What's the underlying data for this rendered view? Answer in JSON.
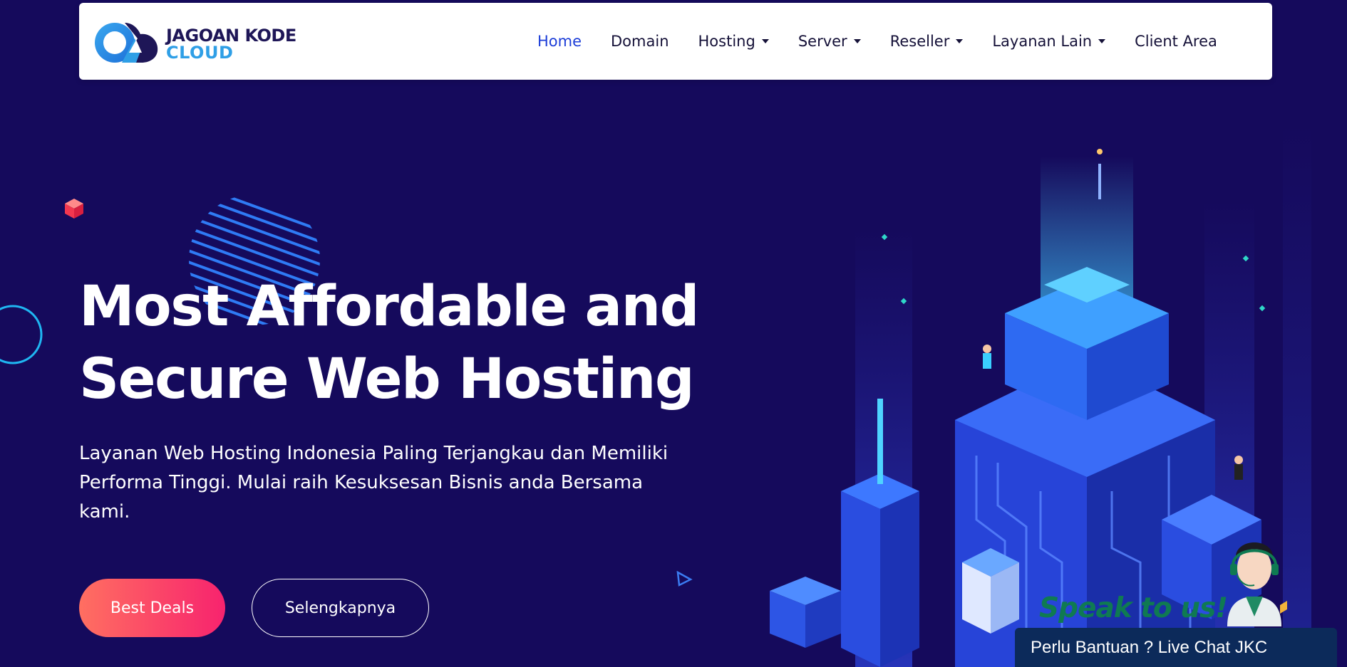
{
  "brand": {
    "name_top": "JAGOAN KODE",
    "name_bottom": "CLOUD",
    "colors": {
      "navy": "#1e1657",
      "blue": "#2f9fe6",
      "background": "#150a5c"
    }
  },
  "nav": {
    "items": [
      {
        "label": "Home",
        "active": true,
        "dropdown": false
      },
      {
        "label": "Domain",
        "active": false,
        "dropdown": false
      },
      {
        "label": "Hosting",
        "active": false,
        "dropdown": true
      },
      {
        "label": "Server",
        "active": false,
        "dropdown": true
      },
      {
        "label": "Reseller",
        "active": false,
        "dropdown": true
      },
      {
        "label": "Layanan Lain",
        "active": false,
        "dropdown": true
      },
      {
        "label": "Client Area",
        "active": false,
        "dropdown": false
      }
    ]
  },
  "hero": {
    "title_line1": "Most Affordable and",
    "title_line2": "Secure Web Hosting",
    "subtitle": "Layanan Web Hosting Indonesia Paling Terjangkau dan Memiliki Performa Tinggi. Mulai raih Kesuksesan Bisnis anda Bersama kami.",
    "primary_button": "Best Deals",
    "secondary_button": "Selengkapnya",
    "button_gradient": [
      "#ff6f61",
      "#f7236e"
    ]
  },
  "chat": {
    "speak_label": "Speak to us!",
    "bar_label": "Perlu Bantuan ? Live Chat JKC",
    "bar_color": "#0c2a5a"
  },
  "icons": [
    "cloud-logo-icon",
    "chevron-down-icon",
    "cube-icon",
    "ring-icon",
    "triangle-icon",
    "server-city-illustration",
    "support-agent-avatar"
  ]
}
